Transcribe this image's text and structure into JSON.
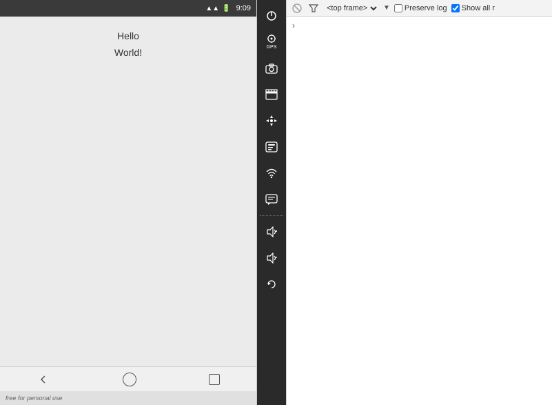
{
  "emulator": {
    "status_bar": {
      "time": "9:09",
      "wifi_icon": "📶",
      "signal_icon": "📡",
      "battery_icon": "🔋"
    },
    "content": {
      "hello_text": "Hello",
      "world_text": "World!"
    },
    "bottom_bar": {
      "text": "free for personal use"
    },
    "toolbar_icons": [
      {
        "id": "power",
        "symbol": "⏻",
        "label": ""
      },
      {
        "id": "gps",
        "symbol": "◉",
        "label": "GPS"
      },
      {
        "id": "camera",
        "symbol": "📷",
        "label": ""
      },
      {
        "id": "clapper",
        "symbol": "🎬",
        "label": ""
      },
      {
        "id": "move",
        "symbol": "✛",
        "label": ""
      },
      {
        "id": "id-badge",
        "symbol": "ID",
        "label": ""
      },
      {
        "id": "wifi",
        "symbol": "))) ",
        "label": ""
      },
      {
        "id": "message",
        "symbol": "💬",
        "label": ""
      },
      {
        "id": "vol-up",
        "symbol": "🔊+",
        "label": ""
      },
      {
        "id": "vol-down",
        "symbol": "🔉-",
        "label": ""
      },
      {
        "id": "rotate",
        "symbol": "⟳",
        "label": ""
      }
    ]
  },
  "devtools": {
    "toolbar": {
      "block_icon": "🚫",
      "filter_icon": "▽",
      "frame_select": "<top frame>",
      "chevron": "▼",
      "preserve_log_label": "Preserve log",
      "show_all_label": "Show all r"
    },
    "content": {
      "arrow": "›"
    }
  }
}
